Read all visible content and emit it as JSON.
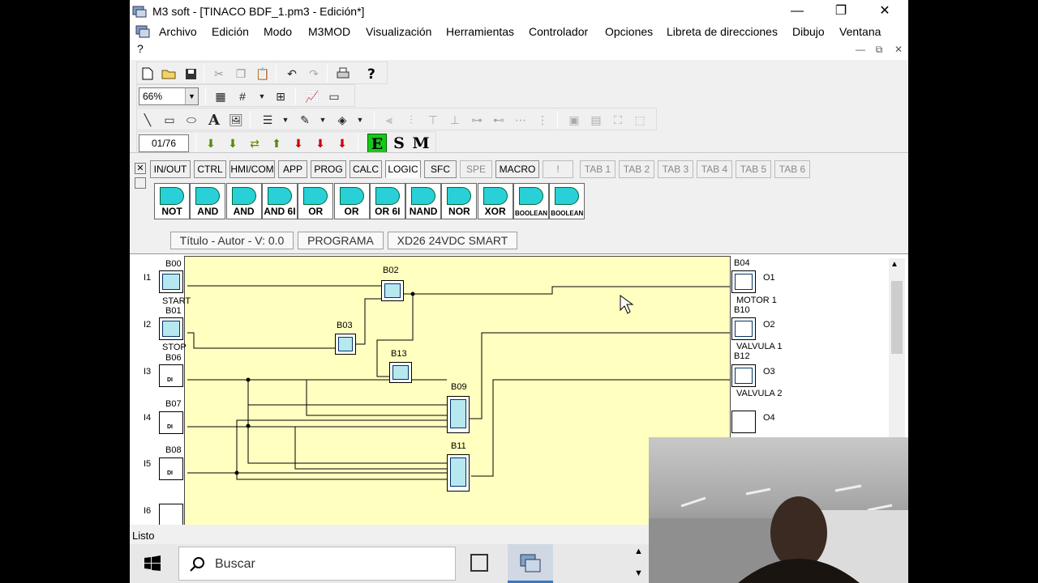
{
  "window": {
    "title": "M3 soft - [TINACO BDF_1.pm3 - Edición*]",
    "minimize": "—",
    "maximize": "❐",
    "close": "✕"
  },
  "menu": {
    "items": [
      "Archivo",
      "Edición",
      "Modo",
      "M3MOD",
      "Visualización",
      "Herramientas",
      "Controlador",
      "Opciones",
      "Libreta de direcciones",
      "Dibujo",
      "Ventana"
    ],
    "help": "?"
  },
  "mdi": {
    "minimize": "—",
    "restore": "⧉",
    "close": "✕"
  },
  "toolbar": {
    "zoom": "66%",
    "page": "01/76",
    "mode_letters": [
      "E",
      "S",
      "M"
    ]
  },
  "function_tabs": [
    "IN/OUT",
    "CTRL",
    "HMI/COM",
    "APP",
    "PROG",
    "CALC",
    "LOGIC",
    "SFC",
    "SPE",
    "MACRO",
    "!",
    "TAB 1",
    "TAB 2",
    "TAB 3",
    "TAB 4",
    "TAB 5",
    "TAB 6"
  ],
  "active_tab": "LOGIC",
  "logic_blocks": [
    "NOT",
    "AND",
    "AND",
    "AND 6I",
    "OR",
    "OR",
    "OR 6I",
    "NAND",
    "NOR",
    "XOR",
    "BOOLEAN",
    "BOOLEAN"
  ],
  "info": {
    "title": "Título - Autor - V: 0.0",
    "program": "PROGRAMA",
    "controller": "XD26 24VDC SMART"
  },
  "diagram": {
    "inputs": [
      {
        "label": "I1",
        "block": "B00",
        "tag": "START"
      },
      {
        "label": "I2",
        "block": "B01",
        "tag": "STOP"
      },
      {
        "label": "I3",
        "block": "B06",
        "tag": "DI"
      },
      {
        "label": "I4",
        "block": "B07",
        "tag": "DI"
      },
      {
        "label": "I5",
        "block": "B08",
        "tag": "DI"
      },
      {
        "label": "I6",
        "block": "",
        "tag": ""
      }
    ],
    "functions": [
      {
        "id": "B02",
        "type": "AND"
      },
      {
        "id": "B03",
        "type": "NOT"
      },
      {
        "id": "B13",
        "type": "NOT"
      },
      {
        "id": "B09",
        "type": "BOOLEAN"
      },
      {
        "id": "B11",
        "type": "BOOLEAN"
      }
    ],
    "outputs": [
      {
        "label": "O1",
        "block": "B04",
        "tag": "MOTOR 1"
      },
      {
        "label": "O2",
        "block": "B10",
        "tag": "VALVULA 1"
      },
      {
        "label": "O3",
        "block": "B12",
        "tag": "VALVULA 2"
      },
      {
        "label": "O4",
        "block": "",
        "tag": ""
      }
    ]
  },
  "status": "Listo",
  "taskbar": {
    "search": "Buscar"
  }
}
